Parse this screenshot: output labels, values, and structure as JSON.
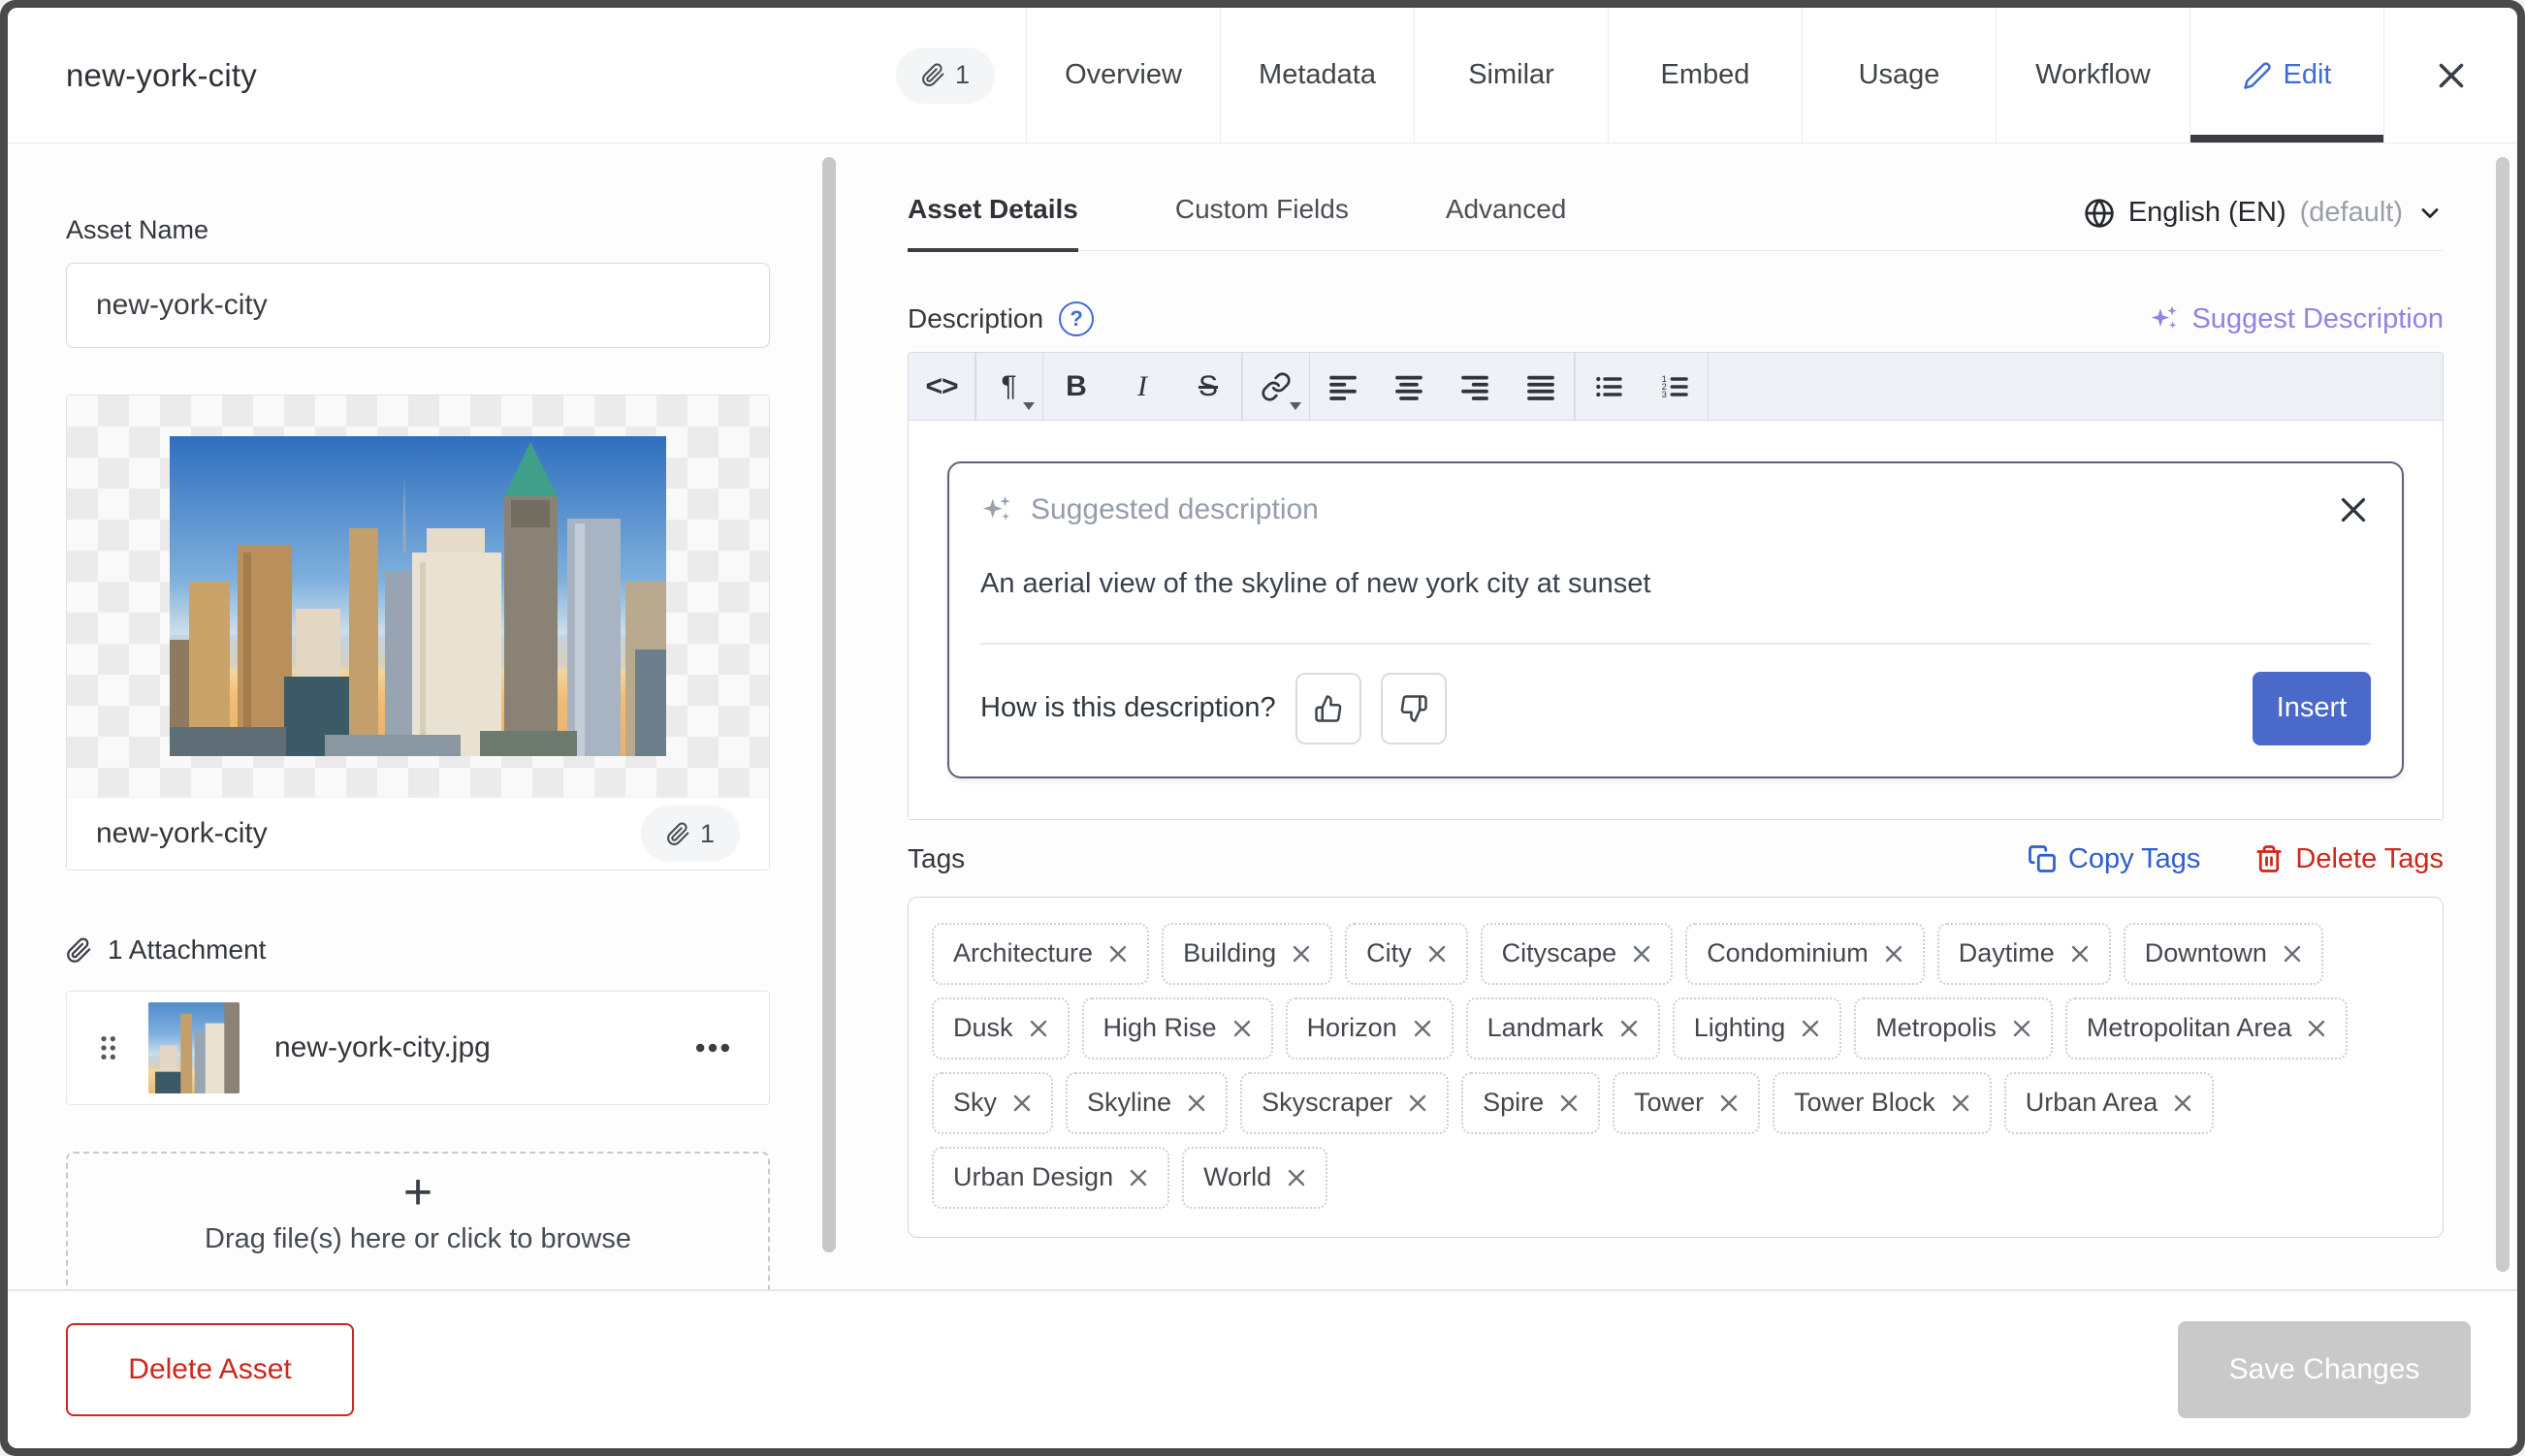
{
  "header": {
    "title": "new-york-city",
    "attachment_badge": "1",
    "tabs": [
      {
        "label": "Overview"
      },
      {
        "label": "Metadata"
      },
      {
        "label": "Similar"
      },
      {
        "label": "Embed"
      },
      {
        "label": "Usage"
      },
      {
        "label": "Workflow"
      },
      {
        "label": "Edit"
      }
    ]
  },
  "left_panel": {
    "asset_name_label": "Asset Name",
    "asset_name_value": "new-york-city",
    "preview_caption": "new-york-city",
    "preview_badge": "1",
    "attachments_header": "1 Attachment",
    "attachment_filename": "new-york-city.jpg",
    "dropzone_plus": "+",
    "dropzone_text": "Drag file(s) here or click to browse"
  },
  "right_panel": {
    "tabs": [
      {
        "label": "Asset Details"
      },
      {
        "label": "Custom Fields"
      },
      {
        "label": "Advanced"
      }
    ],
    "language": {
      "name": "English (EN)",
      "default_suffix": "(default)"
    },
    "description_label": "Description",
    "help_glyph": "?",
    "suggest_label": "Suggest Description",
    "toolbar": {
      "code": "<>",
      "paragraph": "¶",
      "bold": "B",
      "italic": "I",
      "strike": "S"
    },
    "suggestion": {
      "title": "Suggested description",
      "text": "An aerial view of the skyline of new york city at sunset",
      "feedback_question": "How is this description?",
      "insert_label": "Insert"
    },
    "tags": {
      "label": "Tags",
      "copy_label": "Copy Tags",
      "delete_label": "Delete Tags",
      "items": [
        "Architecture",
        "Building",
        "City",
        "Cityscape",
        "Condominium",
        "Daytime",
        "Downtown",
        "Dusk",
        "High Rise",
        "Horizon",
        "Landmark",
        "Lighting",
        "Metropolis",
        "Metropolitan Area",
        "Sky",
        "Skyline",
        "Skyscraper",
        "Spire",
        "Tower",
        "Tower Block",
        "Urban Area",
        "Urban Design",
        "World"
      ]
    }
  },
  "footer": {
    "delete_label": "Delete Asset",
    "save_label": "Save Changes"
  },
  "colors": {
    "accent_blue": "#3d6bd8",
    "insert_blue": "#4a69c8",
    "link_blue": "#2e5ece",
    "danger_red": "#cc281d",
    "suggest_purple": "#9381e6",
    "active_tab_bar": "#3a3d42"
  }
}
